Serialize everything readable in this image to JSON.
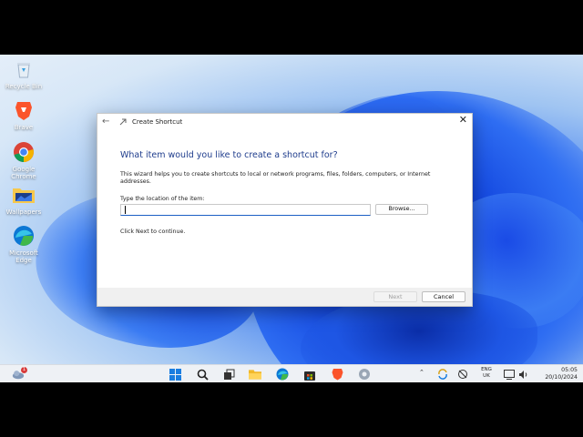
{
  "desktop": {
    "icons": [
      {
        "label": "Recycle Bin",
        "icon": "recycle-bin-icon"
      },
      {
        "label": "Brave",
        "icon": "brave-icon"
      },
      {
        "label": "Google Chrome",
        "icon": "chrome-icon"
      },
      {
        "label": "Wallpapers",
        "icon": "folder-icon"
      },
      {
        "label": "Microsoft Edge",
        "icon": "edge-icon"
      }
    ]
  },
  "dialog": {
    "back_glyph": "←",
    "title": "Create Shortcut",
    "close_glyph": "✕",
    "heading": "What item would you like to create a shortcut for?",
    "description": "This wizard helps you to create shortcuts to local or network programs, files, folders, computers, or Internet addresses.",
    "location_label": "Type the location of the item:",
    "location_value": "",
    "browse_label": "Browse...",
    "hint": "Click Next to continue.",
    "next_label": "Next",
    "cancel_label": "Cancel"
  },
  "taskbar": {
    "weather_badge": "1",
    "language_line1": "ENG",
    "language_line2": "UK",
    "time": "05:05",
    "date": "20/10/2024"
  },
  "colors": {
    "heading": "#1e3c8c",
    "accent": "#1c5fc5",
    "taskbar": "#eef1f5"
  }
}
